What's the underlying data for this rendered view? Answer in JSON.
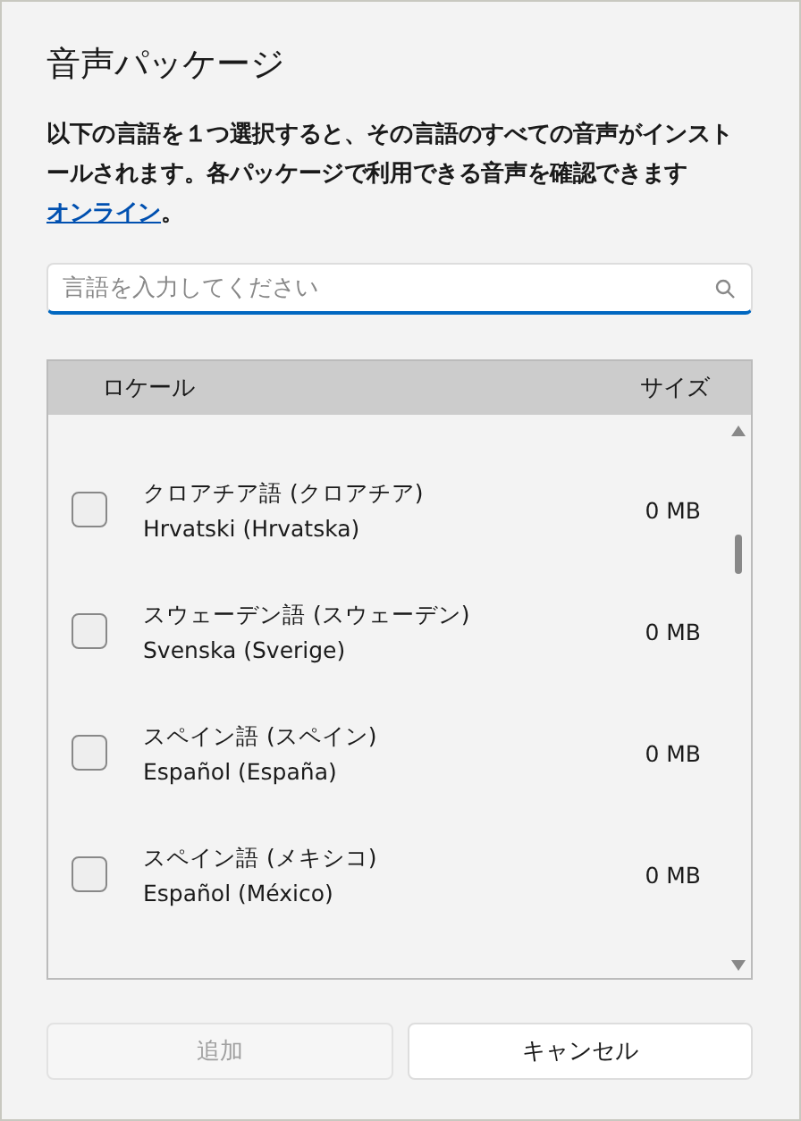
{
  "dialog": {
    "title": "音声パッケージ",
    "description": "以下の言語を１つ選択すると、その言語のすべての音声がインストールされます。各パッケージで利用できる音声を確認できます",
    "link": "オンライン",
    "link_suffix": "。"
  },
  "search": {
    "placeholder": "言語を入力してください"
  },
  "table": {
    "columns": [
      "ロケール",
      "サイズ"
    ],
    "rows": [
      {
        "name": "クロアチア語 (クロアチア)",
        "native": "Hrvatski (Hrvatska)",
        "size": "0 MB",
        "checked": false
      },
      {
        "name": "スウェーデン語 (スウェーデン)",
        "native": "Svenska (Sverige)",
        "size": "0 MB",
        "checked": false
      },
      {
        "name": "スペイン語 (スペイン)",
        "native": "Español (España)",
        "size": "0 MB",
        "checked": false
      },
      {
        "name": "スペイン語 (メキシコ)",
        "native": "Español (México)",
        "size": "0 MB",
        "checked": false
      }
    ]
  },
  "buttons": [
    {
      "label": "追加",
      "disabled": true
    },
    {
      "label": "キャンセル",
      "disabled": false
    }
  ]
}
